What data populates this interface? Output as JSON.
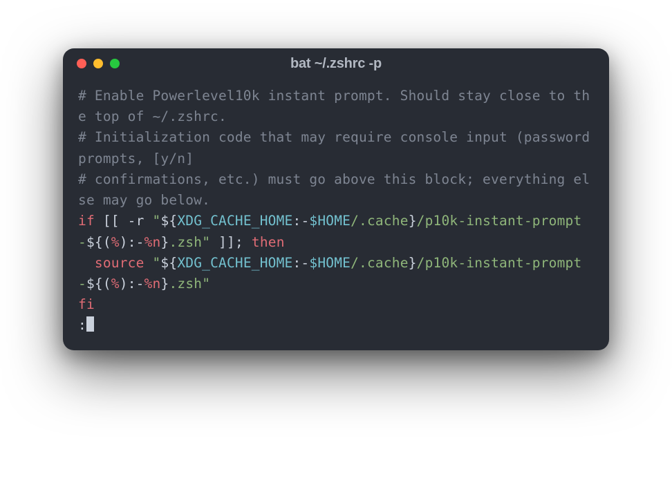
{
  "window": {
    "title": "bat ~/.zshrc -p"
  },
  "code": {
    "comment1": "# Enable Powerlevel10k instant prompt. Should stay close to the top of ~/.zshrc.",
    "comment2": "# Initialization code that may require console input (password prompts, [y/n]",
    "comment3": "# confirmations, etc.) must go above this block; everything else may go below.",
    "if_kw": "if",
    "test_open": " [[ ",
    "test_flag": "-r",
    "str_q1": " \"",
    "var_open1": "${",
    "var_name1": "XDG_CACHE_HOME",
    "var_default1": ":-",
    "var_home1": "$HOME",
    "path1a": "/.cache",
    "var_close1": "}",
    "path1b": "/p10k-instant-prompt-",
    "var_open2": "${",
    "paren_open1": "(",
    "percent1": "%",
    "paren_close1": ")",
    "var_default2": ":-",
    "percent_n1": "%n",
    "var_close2": "}",
    "ext1": ".zsh",
    "str_q2": "\"",
    "test_close": " ]]",
    "semi": ";",
    "then_kw": " then",
    "indent": "  ",
    "source_cmd": "source",
    "str_q3": " \"",
    "var_open3": "${",
    "var_name2": "XDG_CACHE_HOME",
    "var_default3": ":-",
    "var_home2": "$HOME",
    "path2a": "/.cache",
    "var_close3": "}",
    "path2b": "/p10k-instant-prompt-",
    "var_open4": "${",
    "paren_open2": "(",
    "percent2": "%",
    "paren_close2": ")",
    "var_default4": ":-",
    "percent_n2": "%n",
    "var_close4": "}",
    "ext2": ".zsh",
    "str_q4": "\"",
    "fi_kw": "fi",
    "prompt": ":"
  },
  "colors": {
    "bg": "#282c34",
    "comment": "#7e8592",
    "keyword": "#e06c75",
    "string": "#8fb67a",
    "default": "#cad1dc",
    "variable": "#73c1cf"
  }
}
